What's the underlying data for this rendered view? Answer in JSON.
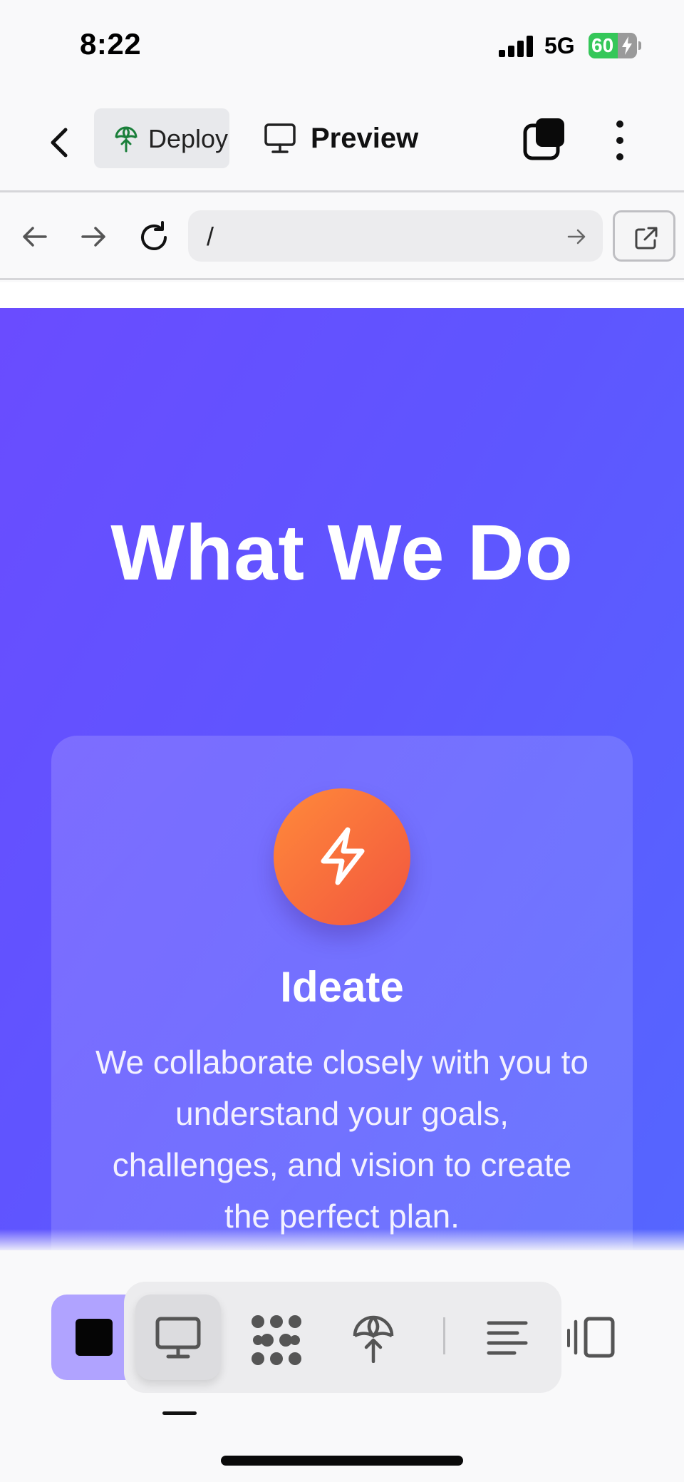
{
  "status_bar": {
    "time": "8:22",
    "network": "5G",
    "battery_level": "60",
    "battery_fraction": 0.6,
    "battery_charging": true
  },
  "app_bar": {
    "deploy_label": "Deploy",
    "preview_label": "Preview",
    "icons": [
      "chevron-left-icon",
      "deploy-icon",
      "monitor-icon",
      "tabs-icon",
      "more-vertical-icon"
    ]
  },
  "browser_bar": {
    "url_value": "/",
    "icons": [
      "arrow-left-icon",
      "arrow-right-icon",
      "reload-icon",
      "go-arrow-icon",
      "external-link-icon"
    ]
  },
  "preview": {
    "section_title": "What We Do",
    "card": {
      "icon": "lightning-icon",
      "title": "Ideate",
      "body": "We collaborate closely with you to understand your goals, challenges, and vision to create the perfect plan."
    },
    "colors": {
      "gradient_start": "#6a4cff",
      "gradient_end": "#5566ff",
      "icon_gradient_start": "#ff8a3a",
      "icon_gradient_end": "#f2553f"
    }
  },
  "bottom_bar": {
    "tools": [
      "stop-icon",
      "monitor-icon",
      "agent-dots-icon",
      "deploy-icon",
      "text-align-icon",
      "panel-layout-icon"
    ],
    "active_tool": "monitor-icon",
    "stop_button_color": "#b0a3ff"
  }
}
